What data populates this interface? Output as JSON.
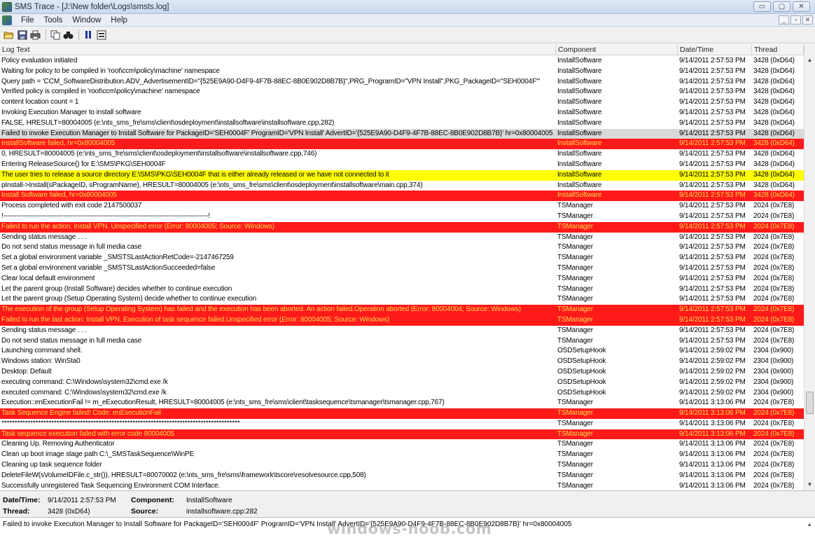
{
  "window": {
    "title": "SMS Trace - [J:\\New folder\\Logs\\smsts.log]",
    "controls": [
      "▭",
      "▢",
      "✕"
    ]
  },
  "menu": {
    "items": [
      "File",
      "Tools",
      "Window",
      "Help"
    ],
    "mdi_controls": [
      "_",
      "▫",
      "✕"
    ]
  },
  "toolbar": {
    "icons": [
      "open-folder-icon",
      "save-icon",
      "print-icon",
      "copy-icon",
      "find-icon",
      "pause-icon",
      "highlight-icon"
    ]
  },
  "columns": {
    "log_text": "Log Text",
    "component": "Component",
    "date_time": "Date/Time",
    "thread": "Thread"
  },
  "colors": {
    "error_bg": "#ff1a1a",
    "error_text": "#ffd84a",
    "warning_bg": "#ffff00"
  },
  "rows": [
    {
      "text": "Policy evaluation initiated",
      "component": "InstallSoftware",
      "date": "9/14/2011 2:57:53 PM",
      "thread": "3428 (0xD64)",
      "level": "info"
    },
    {
      "text": "Waiting for policy to be compiled in 'root\\ccm\\policy\\machine' namespace",
      "component": "InstallSoftware",
      "date": "9/14/2011 2:57:53 PM",
      "thread": "3428 (0xD64)",
      "level": "info"
    },
    {
      "text": "Query path = 'CCM_SoftwareDistribution.ADV_AdvertisementID=\"{525E9A90-D4F9-4F7B-88EC-8B0E902D8B7B}\",PRG_ProgramID=\"VPN Install\",PKG_PackageID=\"SEH0004F\"'",
      "component": "InstallSoftware",
      "date": "9/14/2011 2:57:53 PM",
      "thread": "3428 (0xD64)",
      "level": "info"
    },
    {
      "text": "Verified policy is compiled in 'root\\ccm\\policy\\machine' namespace",
      "component": "InstallSoftware",
      "date": "9/14/2011 2:57:53 PM",
      "thread": "3428 (0xD64)",
      "level": "info"
    },
    {
      "text": "content location count = 1",
      "component": "InstallSoftware",
      "date": "9/14/2011 2:57:53 PM",
      "thread": "3428 (0xD64)",
      "level": "info"
    },
    {
      "text": "Invoking Execution Manager to install software",
      "component": "InstallSoftware",
      "date": "9/14/2011 2:57:53 PM",
      "thread": "3428 (0xD64)",
      "level": "info"
    },
    {
      "text": "FALSE, HRESULT=80004005 (e:\\nts_sms_fre\\sms\\client\\osdeployment\\installsoftware\\installsoftware.cpp,282)",
      "component": "InstallSoftware",
      "date": "9/14/2011 2:57:53 PM",
      "thread": "3428 (0xD64)",
      "level": "info"
    },
    {
      "text": "Failed to invoke Execution Manager to Install Software for PackageID='SEH0004F' ProgramID='VPN Install' AdvertID='{525E9A90-D4F9-4F7B-88EC-8B0E902D8B7B}' hr=0x80004005",
      "component": "InstallSoftware",
      "date": "9/14/2011 2:57:53 PM",
      "thread": "3428 (0xD64)",
      "level": "selected"
    },
    {
      "text": "InstallSoftware failed, hr=0x80004005",
      "component": "InstallSoftware",
      "date": "9/14/2011 2:57:53 PM",
      "thread": "3428 (0xD64)",
      "level": "error"
    },
    {
      "text": "0, HRESULT=80004005 (e:\\nts_sms_fre\\sms\\client\\osdeployment\\installsoftware\\installsoftware.cpp,746)",
      "component": "InstallSoftware",
      "date": "9/14/2011 2:57:53 PM",
      "thread": "3428 (0xD64)",
      "level": "info"
    },
    {
      "text": "Entering ReleaseSource() for E:\\SMS\\PKG\\SEH0004F",
      "component": "InstallSoftware",
      "date": "9/14/2011 2:57:53 PM",
      "thread": "3428 (0xD64)",
      "level": "info"
    },
    {
      "text": "The user tries to release a source directory E:\\SMS\\PKG\\SEH0004F that is either already released or we have not connected to it",
      "component": "InstallSoftware",
      "date": "9/14/2011 2:57:53 PM",
      "thread": "3428 (0xD64)",
      "level": "warning"
    },
    {
      "text": "pInstall->Install(sPackageID, sProgramName), HRESULT=80004005 (e:\\nts_sms_fre\\sms\\client\\osdeployment\\installsoftware\\main.cpp,374)",
      "component": "InstallSoftware",
      "date": "9/14/2011 2:57:53 PM",
      "thread": "3428 (0xD64)",
      "level": "info"
    },
    {
      "text": "Install Software failed, hr=0x80004005",
      "component": "InstallSoftware",
      "date": "9/14/2011 2:57:53 PM",
      "thread": "3428 (0xD64)",
      "level": "error"
    },
    {
      "text": "Process completed with exit code 2147500037",
      "component": "TSManager",
      "date": "9/14/2011 2:57:53 PM",
      "thread": "2024 (0x7E8)",
      "level": "info"
    },
    {
      "text": "!--------------------------------------------------------------------------------------------!",
      "component": "TSManager",
      "date": "9/14/2011 2:57:53 PM",
      "thread": "2024 (0x7E8)",
      "level": "info"
    },
    {
      "text": "Failed to run the action: Install VPN. Unspecified error (Error: 80004005; Source: Windows)",
      "component": "TSManager",
      "date": "9/14/2011 2:57:53 PM",
      "thread": "2024 (0x7E8)",
      "level": "error"
    },
    {
      "text": "Sending status message . . .",
      "component": "TSManager",
      "date": "9/14/2011 2:57:53 PM",
      "thread": "2024 (0x7E8)",
      "level": "info"
    },
    {
      "text": "Do not send status message in full media case",
      "component": "TSManager",
      "date": "9/14/2011 2:57:53 PM",
      "thread": "2024 (0x7E8)",
      "level": "info"
    },
    {
      "text": "Set a global environment variable _SMSTSLastActionRetCode=-2147467259",
      "component": "TSManager",
      "date": "9/14/2011 2:57:53 PM",
      "thread": "2024 (0x7E8)",
      "level": "info"
    },
    {
      "text": "Set a global environment variable _SMSTSLastActionSucceeded=false",
      "component": "TSManager",
      "date": "9/14/2011 2:57:53 PM",
      "thread": "2024 (0x7E8)",
      "level": "info"
    },
    {
      "text": "Clear local default environment",
      "component": "TSManager",
      "date": "9/14/2011 2:57:53 PM",
      "thread": "2024 (0x7E8)",
      "level": "info"
    },
    {
      "text": "Let the parent group (Install Software) decides whether to continue execution",
      "component": "TSManager",
      "date": "9/14/2011 2:57:53 PM",
      "thread": "2024 (0x7E8)",
      "level": "info"
    },
    {
      "text": "Let the parent group (Setup Operating System) decide whether to continue execution",
      "component": "TSManager",
      "date": "9/14/2011 2:57:53 PM",
      "thread": "2024 (0x7E8)",
      "level": "info"
    },
    {
      "text": "The execution of the group (Setup Operating System) has failed and the execution has been aborted. An action failed.Operation aborted (Error: 80004004; Source: Windows)",
      "component": "TSManager",
      "date": "9/14/2011 2:57:53 PM",
      "thread": "2024 (0x7E8)",
      "level": "error"
    },
    {
      "text": "Failed to run the last action: Install VPN. Execution of task sequence failed.Unspecified error (Error: 80004005; Source: Windows)",
      "component": "TSManager",
      "date": "9/14/2011 2:57:53 PM",
      "thread": "2024 (0x7E8)",
      "level": "error"
    },
    {
      "text": "Sending status message . . .",
      "component": "TSManager",
      "date": "9/14/2011 2:57:53 PM",
      "thread": "2024 (0x7E8)",
      "level": "info"
    },
    {
      "text": "Do not send status message in full media case",
      "component": "TSManager",
      "date": "9/14/2011 2:57:53 PM",
      "thread": "2024 (0x7E8)",
      "level": "info"
    },
    {
      "text": "Launching command shell.",
      "component": "OSDSetupHook",
      "date": "9/14/2011 2:59:02 PM",
      "thread": "2304 (0x900)",
      "level": "info"
    },
    {
      "text": "Windows station: WinSta0",
      "component": "OSDSetupHook",
      "date": "9/14/2011 2:59:02 PM",
      "thread": "2304 (0x900)",
      "level": "info"
    },
    {
      "text": "Desktop: Default",
      "component": "OSDSetupHook",
      "date": "9/14/2011 2:59:02 PM",
      "thread": "2304 (0x900)",
      "level": "info"
    },
    {
      "text": "executing command: C:\\Windows\\system32\\cmd.exe /k",
      "component": "OSDSetupHook",
      "date": "9/14/2011 2:59:02 PM",
      "thread": "2304 (0x900)",
      "level": "info"
    },
    {
      "text": "executed command: C:\\Windows\\system32\\cmd.exe /k",
      "component": "OSDSetupHook",
      "date": "9/14/2011 2:59:02 PM",
      "thread": "2304 (0x900)",
      "level": "info"
    },
    {
      "text": "Execution::enExecutionFail != m_eExecutionResult, HRESULT=80004005 (e:\\nts_sms_fre\\sms\\client\\tasksequence\\tsmanager\\tsmanager.cpp,767)",
      "component": "TSManager",
      "date": "9/14/2011 3:13:06 PM",
      "thread": "2024 (0x7E8)",
      "level": "info"
    },
    {
      "text": "Task Sequence Engine failed! Code: enExecutionFail",
      "component": "TSManager",
      "date": "9/14/2011 3:13:06 PM",
      "thread": "2024 (0x7E8)",
      "level": "error"
    },
    {
      "text": "*******************************************************************************************",
      "component": "TSManager",
      "date": "9/14/2011 3:13:06 PM",
      "thread": "2024 (0x7E8)",
      "level": "info"
    },
    {
      "text": "Task sequence execution failed with error code 80004005",
      "component": "TSManager",
      "date": "9/14/2011 3:13:06 PM",
      "thread": "2024 (0x7E8)",
      "level": "error"
    },
    {
      "text": "Cleaning Up. Removing Authenticator",
      "component": "TSManager",
      "date": "9/14/2011 3:13:06 PM",
      "thread": "2024 (0x7E8)",
      "level": "info"
    },
    {
      "text": "Clean up boot image stage path C:\\_SMSTaskSequence\\WinPE",
      "component": "TSManager",
      "date": "9/14/2011 3:13:06 PM",
      "thread": "2024 (0x7E8)",
      "level": "info"
    },
    {
      "text": "Cleaning up task sequence folder",
      "component": "TSManager",
      "date": "9/14/2011 3:13:06 PM",
      "thread": "2024 (0x7E8)",
      "level": "info"
    },
    {
      "text": "DeleteFileW(sVolumeIDFile.c_str()), HRESULT=80070002 (e:\\nts_sms_fre\\sms\\framework\\tscore\\resolvesource.cpp,508)",
      "component": "TSManager",
      "date": "9/14/2011 3:13:06 PM",
      "thread": "2024 (0x7E8)",
      "level": "info"
    },
    {
      "text": "Successfully unregistered Task Sequencing Environment COM Interface.",
      "component": "TSManager",
      "date": "9/14/2011 3:13:06 PM",
      "thread": "2024 (0x7E8)",
      "level": "info"
    }
  ],
  "details": {
    "date_label": "Date/Time:",
    "date_value": "9/14/2011 2:57:53 PM",
    "component_label": "Component:",
    "component_value": "InstallSoftware",
    "thread_label": "Thread:",
    "thread_value": "3428 (0xD64)",
    "source_label": "Source:",
    "source_value": "installsoftware.cpp:282"
  },
  "message": {
    "text": "Failed to invoke Execution Manager to Install Software for PackageID='SEH0004F' ProgramID='VPN Install' AdvertID='{525E9A90-D4F9-4F7B-88EC-8B0E902D8B7B}' hr=0x80004005"
  },
  "watermark": "windows-noob.com"
}
